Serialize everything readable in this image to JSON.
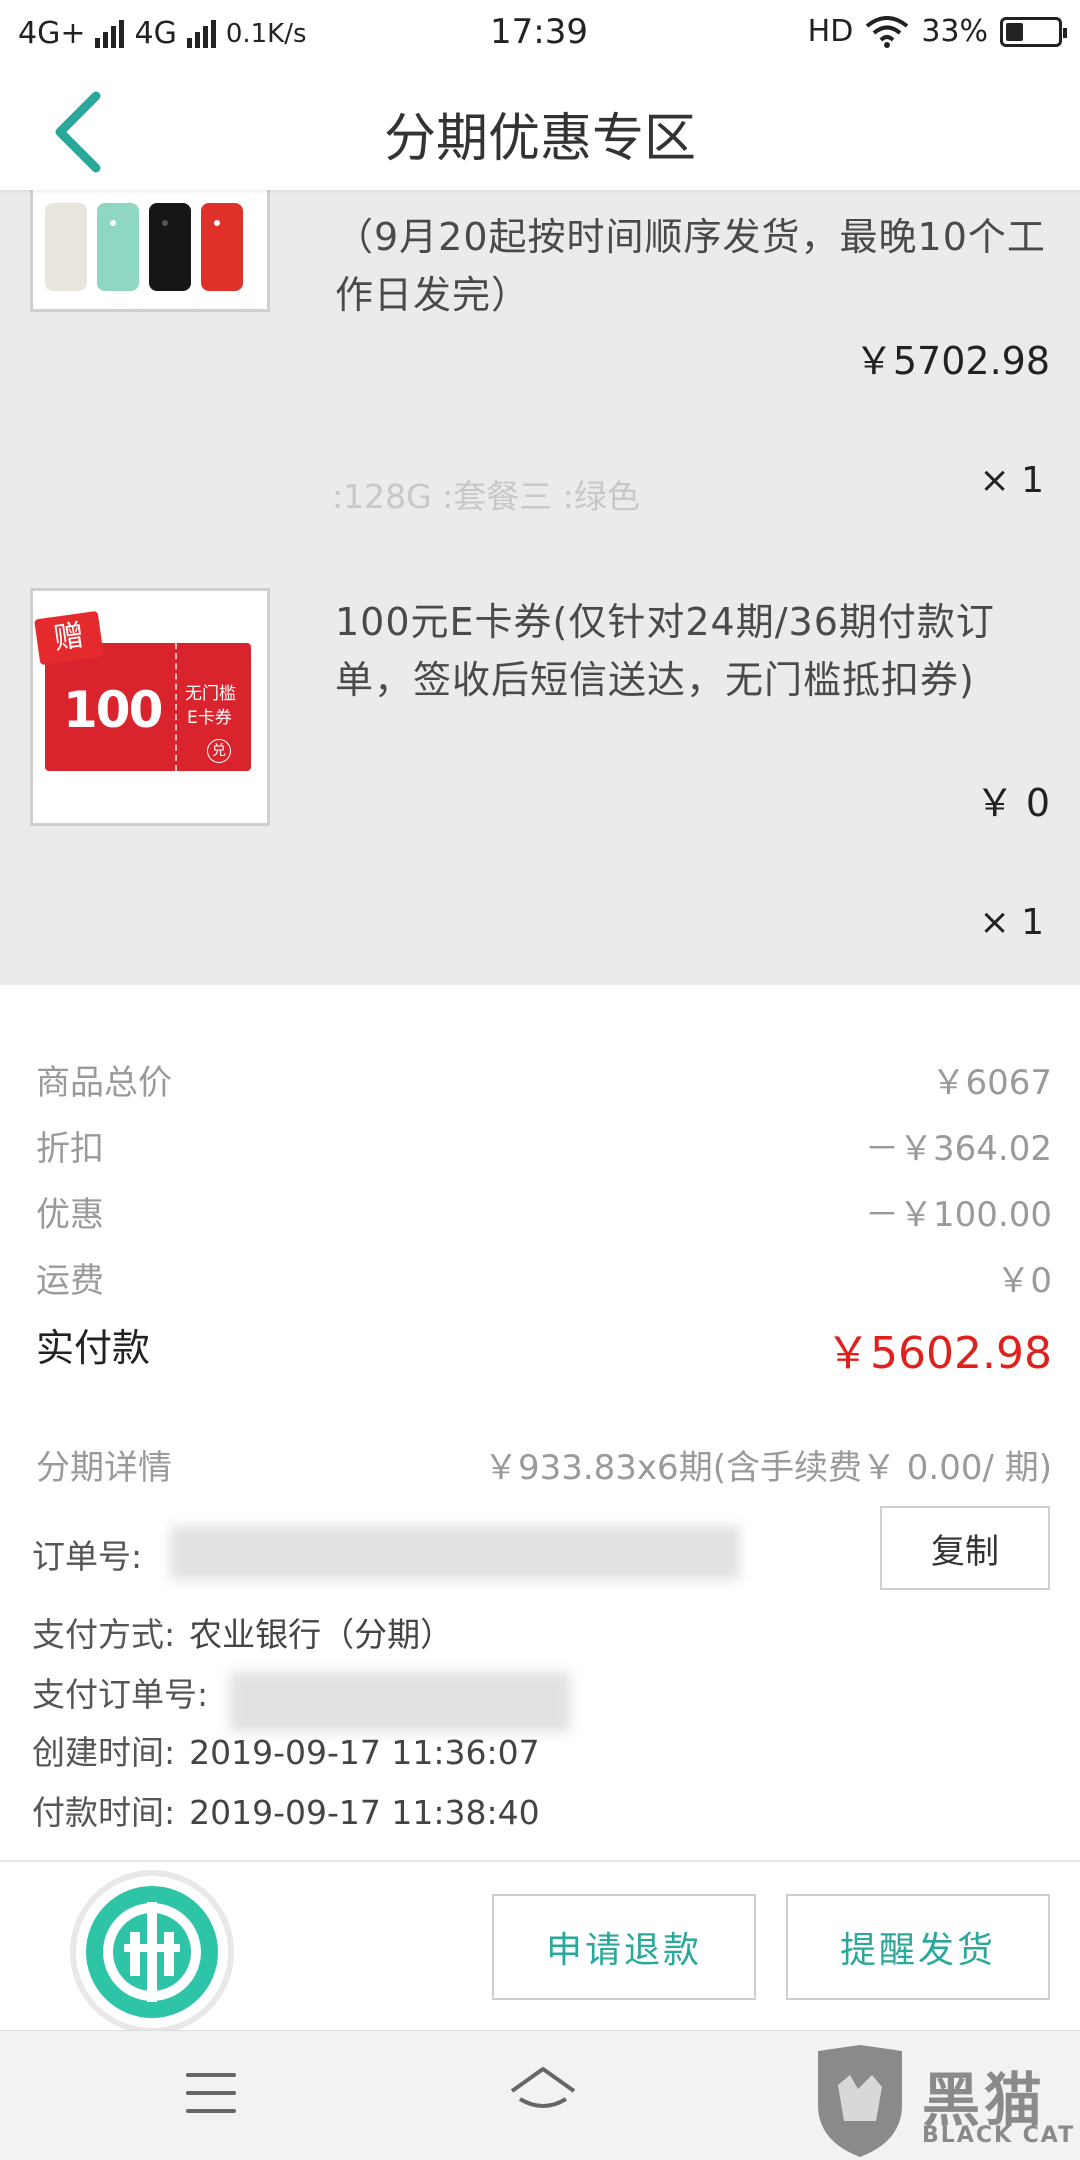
{
  "status_bar": {
    "network1": "4G+",
    "network2": "4G",
    "speed": "0.1K/s",
    "time": "17:39",
    "hd": "HD",
    "battery": "33%",
    "battery_level": 0.33
  },
  "header": {
    "title": "分期优惠专区",
    "back_icon": "chevron-left-icon",
    "accent": "#2aa89a"
  },
  "products": [
    {
      "title": "（9月20起按时间顺序发货，最晚10个工作日发完）",
      "price": "￥5702.98",
      "spec": ":128G :套餐三 :绿色",
      "qty": "× 1",
      "thumb_colors": [
        "#e9e6df",
        "#8fd6c3",
        "#161616",
        "#e0302a"
      ]
    },
    {
      "title": "100元E卡券(仅针对24期/36期付款订单，签收后短信送达，无门槛抵扣券)",
      "price": "￥ 0",
      "qty": "× 1",
      "card": {
        "badge": "赠",
        "amount": "100",
        "line1": "无门槛",
        "line2": "E卡券",
        "corner": "兑"
      }
    }
  ],
  "summary": {
    "rows": [
      {
        "label": "商品总价",
        "value": "￥6067"
      },
      {
        "label": "折扣",
        "value": "－￥364.02"
      },
      {
        "label": "优惠",
        "value": "－￥100.00"
      },
      {
        "label": "运费",
        "value": "￥0"
      }
    ],
    "total_label": "实付款",
    "total_value": "￥5602.98",
    "total_color": "#e0201c"
  },
  "details": {
    "installment_label": "分期详情",
    "installment_value": "￥933.83x6期(含手续费￥ 0.00/ 期)",
    "order_no_label": "订单号:",
    "copy_label": "复制",
    "pay_method_label": "支付方式:",
    "pay_method_value": "农业银行（分期）",
    "pay_order_label": "支付订单号:",
    "created_label": "创建时间:",
    "created_value": "2019-09-17 11:36:07",
    "paid_label": "付款时间:",
    "paid_value": "2019-09-17 11:38:40"
  },
  "actions": {
    "refund_label": "申请退款",
    "remind_label": "提醒发货",
    "bank_logo_icon": "agricultural-bank-logo"
  },
  "navbar": {
    "menu_icon": "menu-icon",
    "home_icon": "home-icon",
    "watermark_text": "黑猫",
    "watermark_sub": "BLACK CAT"
  }
}
